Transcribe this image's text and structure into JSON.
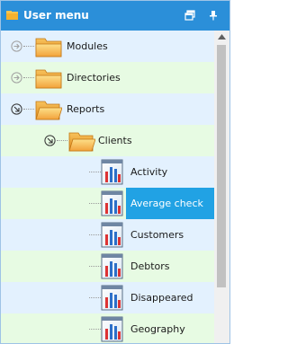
{
  "window": {
    "title": "User menu"
  },
  "icons": {
    "menu": "folder-icon",
    "restore": "restore-window-icon",
    "pin": "pin-icon",
    "expand": "expand-arrow-icon",
    "collapse": "collapse-arrow-icon",
    "folder": "folder-icon",
    "folder_open": "folder-open-icon",
    "report": "report-icon"
  },
  "colors": {
    "titlebar": "#2b8fd9",
    "row_blue": "#e3f1fe",
    "row_green": "#e7fbe3",
    "selection": "#21a2e4"
  },
  "tree": {
    "items": [
      {
        "label": "Modules",
        "type": "folder",
        "state": "collapsed"
      },
      {
        "label": "Directories",
        "type": "folder",
        "state": "collapsed"
      },
      {
        "label": "Reports",
        "type": "folder",
        "state": "expanded"
      },
      {
        "label": "Clients",
        "type": "folder",
        "state": "expanded"
      },
      {
        "label": "Activity",
        "type": "report"
      },
      {
        "label": "Average check",
        "type": "report",
        "selected": true
      },
      {
        "label": "Customers",
        "type": "report"
      },
      {
        "label": "Debtors",
        "type": "report"
      },
      {
        "label": "Disappeared",
        "type": "report"
      },
      {
        "label": "Geography",
        "type": "report"
      }
    ]
  }
}
